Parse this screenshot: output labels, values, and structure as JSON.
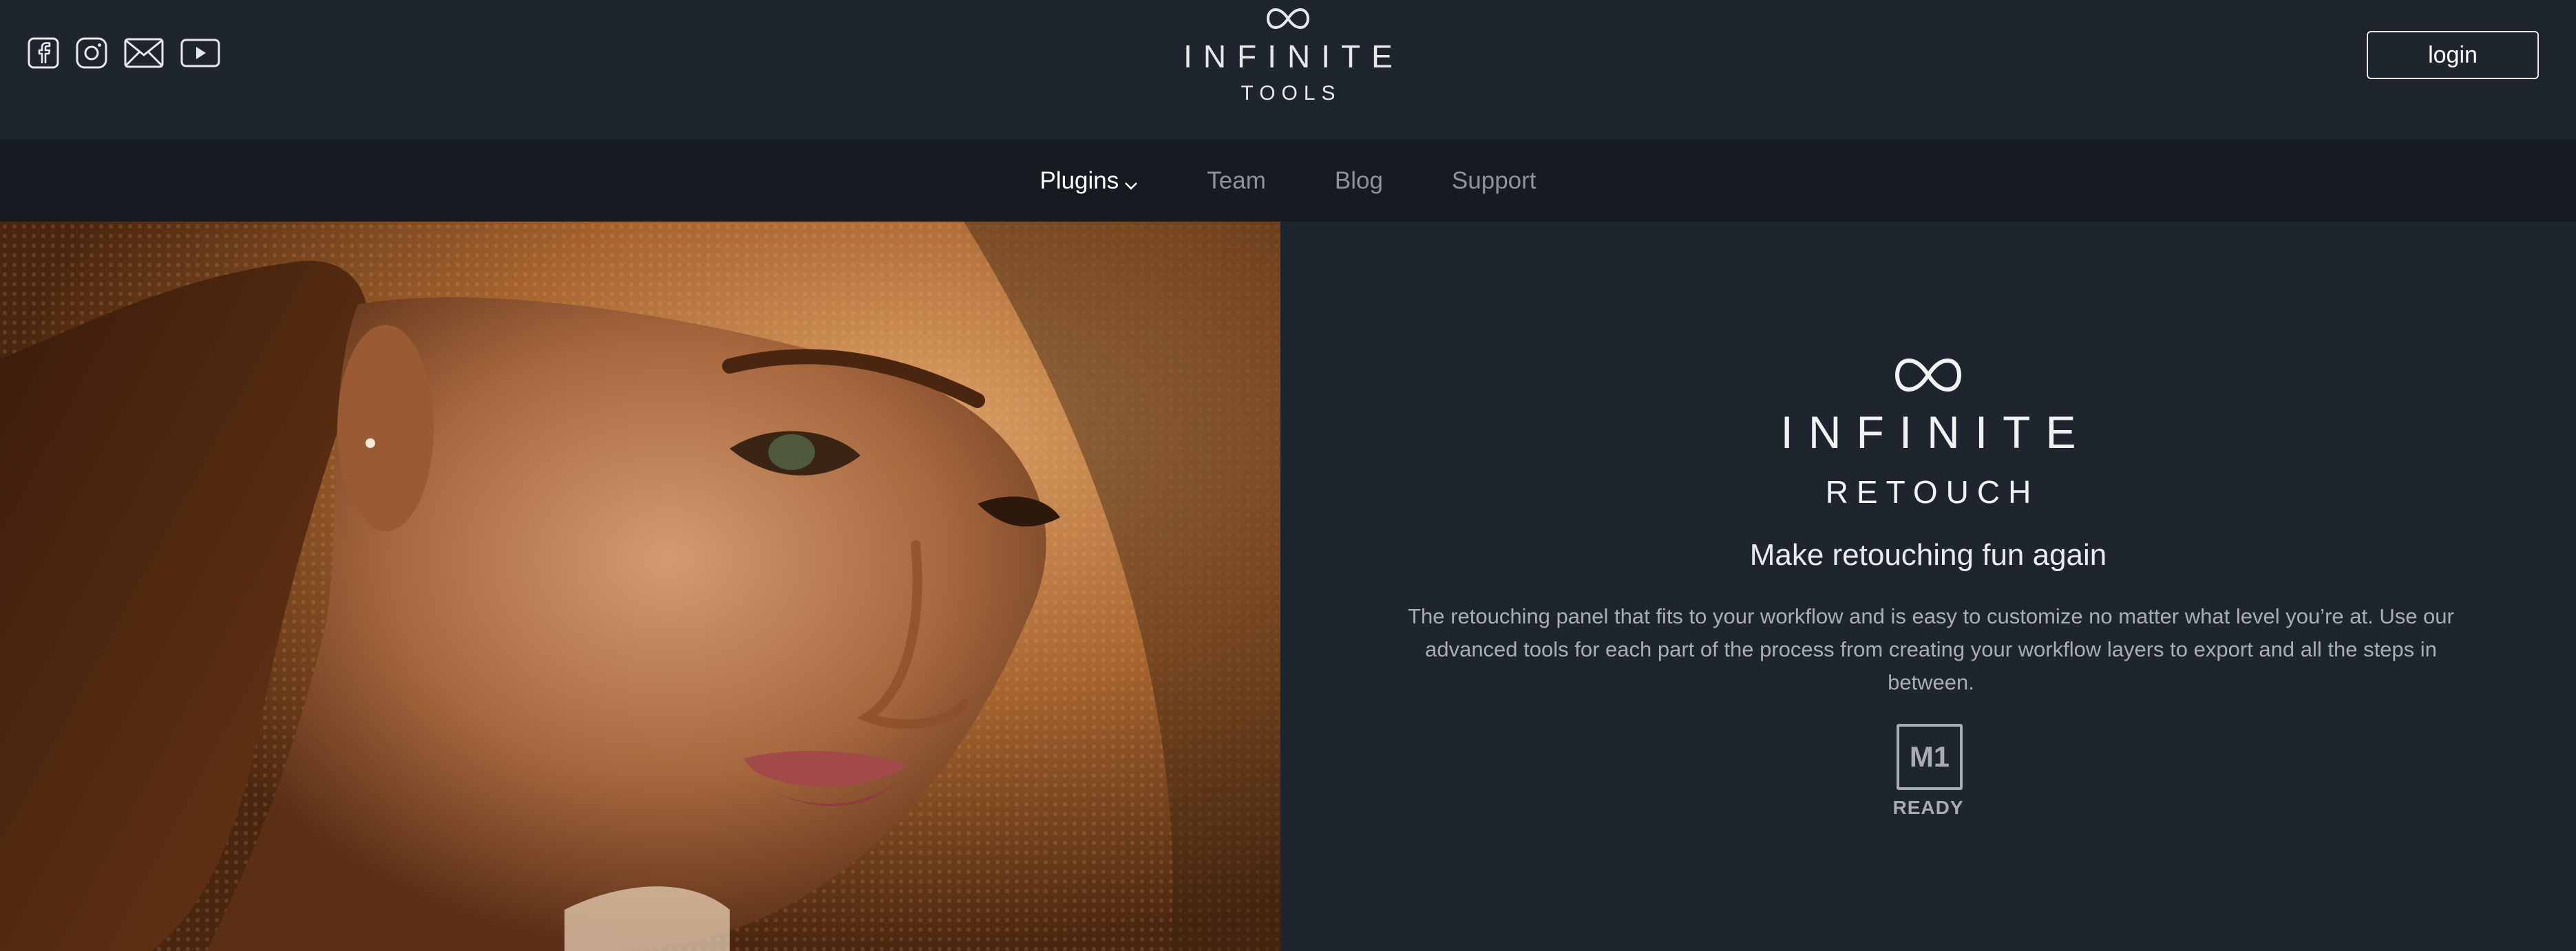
{
  "header": {
    "social": [
      {
        "icon": "facebook-icon"
      },
      {
        "icon": "instagram-icon"
      },
      {
        "icon": "mail-icon"
      },
      {
        "icon": "youtube-icon"
      }
    ],
    "brand": {
      "name": "INFINITE",
      "sub": "TOOLS"
    },
    "login_label": "login"
  },
  "nav": {
    "items": [
      {
        "label": "Plugins",
        "active": true,
        "has_dropdown": true
      },
      {
        "label": "Team"
      },
      {
        "label": "Blog"
      },
      {
        "label": "Support"
      }
    ]
  },
  "hero": {
    "image": "portrait of a woman in a wide-brimmed straw hat",
    "product_name": "INFINITE",
    "product_sub": "RETOUCH",
    "tagline": "Make retouching fun again",
    "description": "The retouching panel that fits to your workflow and is easy to customize no matter what level you’re at. Use our advanced tools for each part of the process from creating your workflow layers to export and all the steps in between.",
    "badge": {
      "text": "M1",
      "label": "READY"
    }
  },
  "colors": {
    "background": "#1f252e",
    "nav_background": "#161b22",
    "text_primary": "#e6e8ea",
    "text_muted": "#a9aeb5"
  }
}
